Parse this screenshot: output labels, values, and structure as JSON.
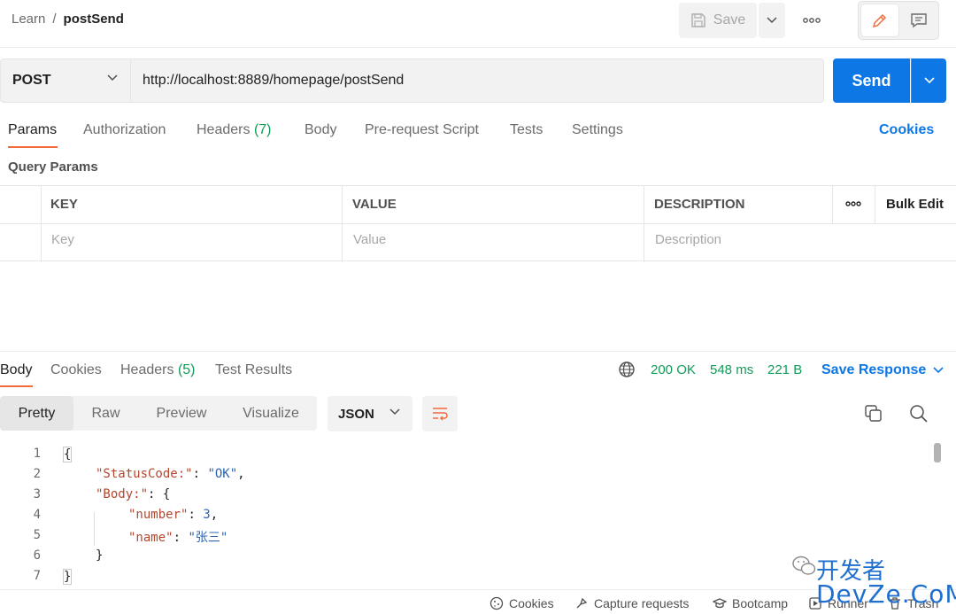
{
  "breadcrumb": {
    "parent": "Learn",
    "separator": "/",
    "current": "postSend"
  },
  "toolbar": {
    "save_label": "Save"
  },
  "request": {
    "method": "POST",
    "url": "http://localhost:8889/homepage/postSend",
    "send_label": "Send"
  },
  "request_tabs": {
    "params": "Params",
    "authorization": "Authorization",
    "headers": "Headers",
    "headers_count": "(7)",
    "body": "Body",
    "prerequest": "Pre-request Script",
    "tests": "Tests",
    "settings": "Settings",
    "cookies": "Cookies"
  },
  "query_params": {
    "title": "Query Params",
    "columns": {
      "key": "KEY",
      "value": "VALUE",
      "description": "DESCRIPTION"
    },
    "bulk_edit": "Bulk Edit",
    "placeholders": {
      "key": "Key",
      "value": "Value",
      "description": "Description"
    }
  },
  "response_tabs": {
    "body": "Body",
    "cookies": "Cookies",
    "headers": "Headers",
    "headers_count": "(5)",
    "test_results": "Test Results"
  },
  "response_status": {
    "status": "200 OK",
    "time": "548 ms",
    "size": "221 B",
    "save_response": "Save Response"
  },
  "view_modes": {
    "pretty": "Pretty",
    "raw": "Raw",
    "preview": "Preview",
    "visualize": "Visualize"
  },
  "format": "JSON",
  "code": {
    "line_numbers": [
      "1",
      "2",
      "3",
      "4",
      "5",
      "6",
      "7"
    ],
    "open_brace": "{",
    "key_status": "\"StatusCode:\"",
    "colon": ": ",
    "val_status": "\"OK\"",
    "comma": ",",
    "key_body": "\"Body:\"",
    "body_open": "{",
    "key_number": "\"number\"",
    "val_number": "3",
    "key_name": "\"name\"",
    "val_name": "\"张三\"",
    "body_close": "}",
    "close_brace": "}"
  },
  "statusbar": {
    "cookies": "Cookies",
    "capture": "Capture requests",
    "bootcamp": "Bootcamp",
    "runner": "Runner",
    "trash": "Trash"
  },
  "watermark": {
    "top": "开发者",
    "bottom": "DevZe.CoM"
  },
  "colors": {
    "accent_blue": "#0d77e6",
    "tab_underline": "#f26b3a",
    "success_green": "#0f9d58",
    "json_key": "#b4472e",
    "json_value": "#2c65b0"
  }
}
